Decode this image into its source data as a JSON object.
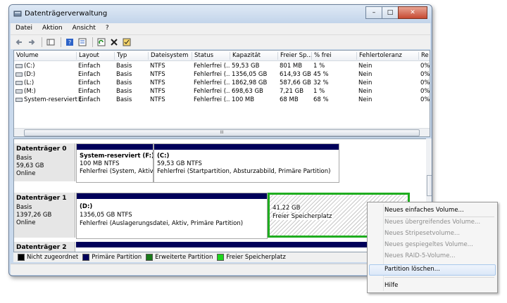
{
  "window": {
    "title": "Datenträgerverwaltung",
    "btn_min": "–",
    "btn_max": "□",
    "btn_close": "✕"
  },
  "menu": [
    "Datei",
    "Aktion",
    "Ansicht",
    "?"
  ],
  "toolbar_icons": [
    "back-arrow-icon",
    "forward-arrow-icon",
    "console-tree-icon",
    "help-icon",
    "properties-icon",
    "refresh-icon",
    "delete-icon",
    "checklist-icon"
  ],
  "volumes": {
    "columns": [
      "Volume",
      "Layout",
      "Typ",
      "Dateisystem",
      "Status",
      "Kapazität",
      "Freier Sp...",
      "% frei",
      "Fehlertoleranz",
      "Re"
    ],
    "rows": [
      [
        "(C:)",
        "Einfach",
        "Basis",
        "NTFS",
        "Fehlerfrei (...",
        "59,53 GB",
        "801 MB",
        "1 %",
        "Nein",
        "0%"
      ],
      [
        "(D:)",
        "Einfach",
        "Basis",
        "NTFS",
        "Fehlerfrei (...",
        "1356,05 GB",
        "614,93 GB",
        "45 %",
        "Nein",
        "0%"
      ],
      [
        "(L:)",
        "Einfach",
        "Basis",
        "NTFS",
        "Fehlerfrei (...",
        "1862,98 GB",
        "587,66 GB",
        "32 %",
        "Nein",
        "0%"
      ],
      [
        "(M:)",
        "Einfach",
        "Basis",
        "NTFS",
        "Fehlerfrei (...",
        "698,63 GB",
        "7,21 GB",
        "1 %",
        "Nein",
        "0%"
      ],
      [
        "System-reserviert (...",
        "Einfach",
        "Basis",
        "NTFS",
        "Fehlerfrei (...",
        "100 MB",
        "68 MB",
        "68 %",
        "Nein",
        "0%"
      ]
    ],
    "scroll_thumb": "III"
  },
  "disks": [
    {
      "name": "Datenträger 0",
      "type": "Basis",
      "size": "59,63 GB",
      "status": "Online",
      "partitions": [
        {
          "title": "System-reserviert  (F:)",
          "size": "100 MB NTFS",
          "status": "Fehlerfrei (System, Aktiv, P"
        },
        {
          "title": "(C:)",
          "size": "59,53 GB NTFS",
          "status": "Fehlerfrei (Startpartition, Absturzabbild, Primäre Partition)"
        }
      ]
    },
    {
      "name": "Datenträger 1",
      "type": "Basis",
      "size": "1397,26 GB",
      "status": "Online",
      "partitions": [
        {
          "title": "(D:)",
          "size": "1356,05 GB NTFS",
          "status": "Fehlerfrei (Auslagerungsdatei, Aktiv, Primäre Partition)"
        },
        {
          "title": "",
          "size": "41,22 GB",
          "status": "Freier Speicherplatz"
        }
      ]
    },
    {
      "name": "Datenträger 2"
    }
  ],
  "legend": [
    {
      "label": "Nicht zugeordnet",
      "color": "#000000"
    },
    {
      "label": "Primäre Partition",
      "color": "#00005a"
    },
    {
      "label": "Erweiterte Partition",
      "color": "#1a7a1a"
    },
    {
      "label": "Freier Speicherplatz",
      "color": "#1fd61f"
    }
  ],
  "context_menu": {
    "items": [
      {
        "label": "Neues einfaches Volume...",
        "enabled": true
      },
      {
        "label": "Neues übergreifendes Volume...",
        "enabled": false
      },
      {
        "label": "Neues Stripesetvolume...",
        "enabled": false
      },
      {
        "label": "Neues gespiegeltes Volume...",
        "enabled": false
      },
      {
        "label": "Neues RAID-5-Volume...",
        "enabled": false
      },
      {
        "label": "Partition löschen...",
        "enabled": true
      },
      {
        "label": "Hilfe",
        "enabled": true
      }
    ]
  }
}
